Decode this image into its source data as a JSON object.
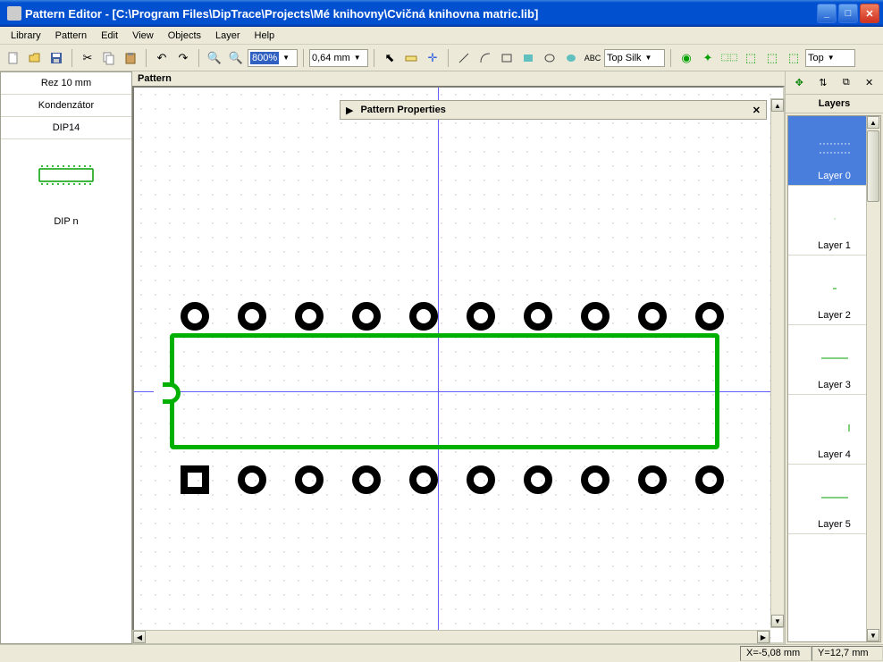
{
  "window": {
    "title": "Pattern Editor - [C:\\Program Files\\DipTrace\\Projects\\Mé knihovny\\Cvičná knihovna matric.lib]"
  },
  "menu": [
    "Library",
    "Pattern",
    "Edit",
    "View",
    "Objects",
    "Layer",
    "Help"
  ],
  "toolbar": {
    "zoom_value": "800%",
    "grid_value": "0,64 mm",
    "layer_combo": "Top Silk",
    "layer_combo2": "Top"
  },
  "left_panel": {
    "items": [
      "Rez 10 mm",
      "Kondenzátor",
      "DIP14"
    ],
    "footer": "DIP n"
  },
  "canvas": {
    "label": "Pattern",
    "properties_title": "Pattern Properties"
  },
  "right_panel": {
    "title": "Layers",
    "layers": [
      "Layer 0",
      "Layer 1",
      "Layer 2",
      "Layer 3",
      "Layer 4",
      "Layer 5"
    ]
  },
  "status": {
    "x": "X=-5,08 mm",
    "y": "Y=12,7 mm"
  }
}
